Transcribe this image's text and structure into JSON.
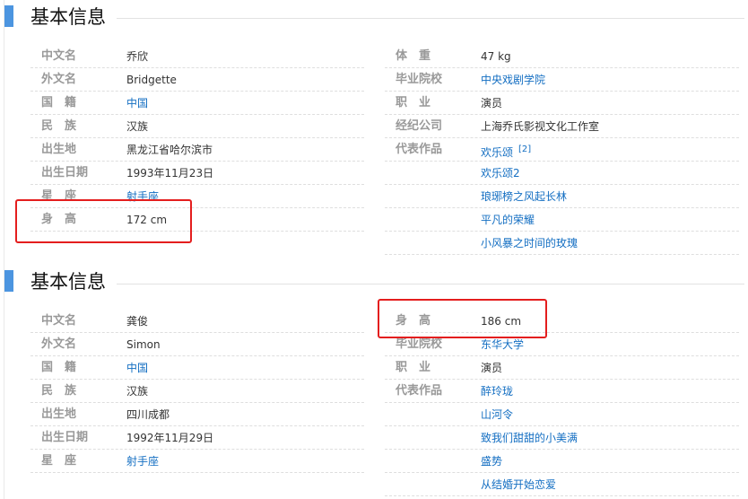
{
  "section1": {
    "title": "基本信息",
    "left": [
      {
        "name_a": "中文名",
        "name_b": "",
        "value": "乔欣",
        "link": false
      },
      {
        "name_a": "外文名",
        "name_b": "",
        "value": "Bridgette",
        "link": false
      },
      {
        "name_a": "国",
        "name_b": "籍",
        "value": "中国",
        "link": true
      },
      {
        "name_a": "民",
        "name_b": "族",
        "value": "汉族",
        "link": false
      },
      {
        "name_a": "出生地",
        "name_b": "",
        "value": "黑龙江省哈尔滨市",
        "link": false
      },
      {
        "name_a": "出生日期",
        "name_b": "",
        "value": "1993年11月23日",
        "link": false
      },
      {
        "name_a": "星",
        "name_b": "座",
        "value": "射手座",
        "link": true
      },
      {
        "name_a": "身",
        "name_b": "高",
        "value": "172 cm",
        "link": false
      }
    ],
    "right": [
      {
        "name_a": "体",
        "name_b": "重",
        "value": "47 kg",
        "link": false
      },
      {
        "name_a": "毕业院校",
        "name_b": "",
        "value": "中央戏剧学院",
        "link": true
      },
      {
        "name_a": "职",
        "name_b": "业",
        "value": "演员",
        "link": false
      },
      {
        "name_a": "经纪公司",
        "name_b": "",
        "value": "上海乔氏影视文化工作室",
        "link": false
      },
      {
        "name_a": "代表作品",
        "name_b": "",
        "value": "欢乐颂",
        "link": true,
        "sup": "[2]"
      },
      {
        "name_a": "",
        "name_b": "",
        "value": "欢乐颂2",
        "link": true
      },
      {
        "name_a": "",
        "name_b": "",
        "value": "琅琊榜之风起长林",
        "link": true
      },
      {
        "name_a": "",
        "name_b": "",
        "value": "平凡的荣耀",
        "link": true
      },
      {
        "name_a": "",
        "name_b": "",
        "value": "小风暴之时间的玫瑰",
        "link": true
      }
    ]
  },
  "section2": {
    "title": "基本信息",
    "left": [
      {
        "name_a": "中文名",
        "name_b": "",
        "value": "龚俊",
        "link": false
      },
      {
        "name_a": "外文名",
        "name_b": "",
        "value": "Simon",
        "link": false
      },
      {
        "name_a": "国",
        "name_b": "籍",
        "value": "中国",
        "link": true
      },
      {
        "name_a": "民",
        "name_b": "族",
        "value": "汉族",
        "link": false
      },
      {
        "name_a": "出生地",
        "name_b": "",
        "value": "四川成都",
        "link": false
      },
      {
        "name_a": "出生日期",
        "name_b": "",
        "value": "1992年11月29日",
        "link": false
      },
      {
        "name_a": "星",
        "name_b": "座",
        "value": "射手座",
        "link": true
      }
    ],
    "right": [
      {
        "name_a": "身",
        "name_b": "高",
        "value": "186 cm",
        "link": false
      },
      {
        "name_a": "毕业院校",
        "name_b": "",
        "value": "东华大学",
        "link": true
      },
      {
        "name_a": "职",
        "name_b": "业",
        "value": "演员",
        "link": false
      },
      {
        "name_a": "代表作品",
        "name_b": "",
        "value": "醉玲珑",
        "link": true
      },
      {
        "name_a": "",
        "name_b": "",
        "value": "山河令",
        "link": true
      },
      {
        "name_a": "",
        "name_b": "",
        "value": "致我们甜甜的小美满",
        "link": true
      },
      {
        "name_a": "",
        "name_b": "",
        "value": "盛势",
        "link": true
      },
      {
        "name_a": "",
        "name_b": "",
        "value": "从结婚开始恋爱",
        "link": true
      }
    ]
  },
  "colors": {
    "accent_bar": "#4c95e0",
    "label": "#999999",
    "link": "#136ec2",
    "highlight_box": "#e41e1e"
  }
}
